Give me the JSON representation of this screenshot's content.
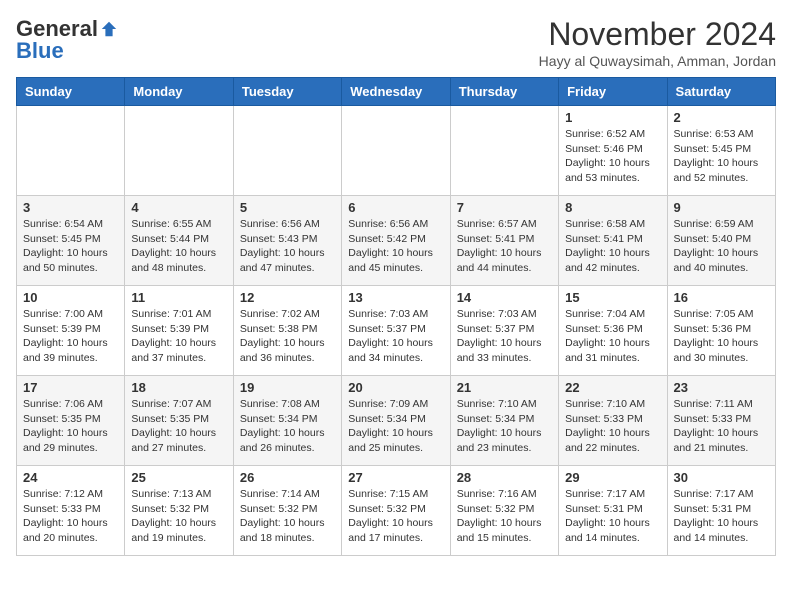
{
  "logo": {
    "general": "General",
    "blue": "Blue"
  },
  "header": {
    "month": "November 2024",
    "location": "Hayy al Quwaysimah, Amman, Jordan"
  },
  "days": [
    "Sunday",
    "Monday",
    "Tuesday",
    "Wednesday",
    "Thursday",
    "Friday",
    "Saturday"
  ],
  "weeks": [
    [
      {
        "day": "",
        "info": ""
      },
      {
        "day": "",
        "info": ""
      },
      {
        "day": "",
        "info": ""
      },
      {
        "day": "",
        "info": ""
      },
      {
        "day": "",
        "info": ""
      },
      {
        "day": "1",
        "info": "Sunrise: 6:52 AM\nSunset: 5:46 PM\nDaylight: 10 hours and 53 minutes."
      },
      {
        "day": "2",
        "info": "Sunrise: 6:53 AM\nSunset: 5:45 PM\nDaylight: 10 hours and 52 minutes."
      }
    ],
    [
      {
        "day": "3",
        "info": "Sunrise: 6:54 AM\nSunset: 5:45 PM\nDaylight: 10 hours and 50 minutes."
      },
      {
        "day": "4",
        "info": "Sunrise: 6:55 AM\nSunset: 5:44 PM\nDaylight: 10 hours and 48 minutes."
      },
      {
        "day": "5",
        "info": "Sunrise: 6:56 AM\nSunset: 5:43 PM\nDaylight: 10 hours and 47 minutes."
      },
      {
        "day": "6",
        "info": "Sunrise: 6:56 AM\nSunset: 5:42 PM\nDaylight: 10 hours and 45 minutes."
      },
      {
        "day": "7",
        "info": "Sunrise: 6:57 AM\nSunset: 5:41 PM\nDaylight: 10 hours and 44 minutes."
      },
      {
        "day": "8",
        "info": "Sunrise: 6:58 AM\nSunset: 5:41 PM\nDaylight: 10 hours and 42 minutes."
      },
      {
        "day": "9",
        "info": "Sunrise: 6:59 AM\nSunset: 5:40 PM\nDaylight: 10 hours and 40 minutes."
      }
    ],
    [
      {
        "day": "10",
        "info": "Sunrise: 7:00 AM\nSunset: 5:39 PM\nDaylight: 10 hours and 39 minutes."
      },
      {
        "day": "11",
        "info": "Sunrise: 7:01 AM\nSunset: 5:39 PM\nDaylight: 10 hours and 37 minutes."
      },
      {
        "day": "12",
        "info": "Sunrise: 7:02 AM\nSunset: 5:38 PM\nDaylight: 10 hours and 36 minutes."
      },
      {
        "day": "13",
        "info": "Sunrise: 7:03 AM\nSunset: 5:37 PM\nDaylight: 10 hours and 34 minutes."
      },
      {
        "day": "14",
        "info": "Sunrise: 7:03 AM\nSunset: 5:37 PM\nDaylight: 10 hours and 33 minutes."
      },
      {
        "day": "15",
        "info": "Sunrise: 7:04 AM\nSunset: 5:36 PM\nDaylight: 10 hours and 31 minutes."
      },
      {
        "day": "16",
        "info": "Sunrise: 7:05 AM\nSunset: 5:36 PM\nDaylight: 10 hours and 30 minutes."
      }
    ],
    [
      {
        "day": "17",
        "info": "Sunrise: 7:06 AM\nSunset: 5:35 PM\nDaylight: 10 hours and 29 minutes."
      },
      {
        "day": "18",
        "info": "Sunrise: 7:07 AM\nSunset: 5:35 PM\nDaylight: 10 hours and 27 minutes."
      },
      {
        "day": "19",
        "info": "Sunrise: 7:08 AM\nSunset: 5:34 PM\nDaylight: 10 hours and 26 minutes."
      },
      {
        "day": "20",
        "info": "Sunrise: 7:09 AM\nSunset: 5:34 PM\nDaylight: 10 hours and 25 minutes."
      },
      {
        "day": "21",
        "info": "Sunrise: 7:10 AM\nSunset: 5:34 PM\nDaylight: 10 hours and 23 minutes."
      },
      {
        "day": "22",
        "info": "Sunrise: 7:10 AM\nSunset: 5:33 PM\nDaylight: 10 hours and 22 minutes."
      },
      {
        "day": "23",
        "info": "Sunrise: 7:11 AM\nSunset: 5:33 PM\nDaylight: 10 hours and 21 minutes."
      }
    ],
    [
      {
        "day": "24",
        "info": "Sunrise: 7:12 AM\nSunset: 5:33 PM\nDaylight: 10 hours and 20 minutes."
      },
      {
        "day": "25",
        "info": "Sunrise: 7:13 AM\nSunset: 5:32 PM\nDaylight: 10 hours and 19 minutes."
      },
      {
        "day": "26",
        "info": "Sunrise: 7:14 AM\nSunset: 5:32 PM\nDaylight: 10 hours and 18 minutes."
      },
      {
        "day": "27",
        "info": "Sunrise: 7:15 AM\nSunset: 5:32 PM\nDaylight: 10 hours and 17 minutes."
      },
      {
        "day": "28",
        "info": "Sunrise: 7:16 AM\nSunset: 5:32 PM\nDaylight: 10 hours and 15 minutes."
      },
      {
        "day": "29",
        "info": "Sunrise: 7:17 AM\nSunset: 5:31 PM\nDaylight: 10 hours and 14 minutes."
      },
      {
        "day": "30",
        "info": "Sunrise: 7:17 AM\nSunset: 5:31 PM\nDaylight: 10 hours and 14 minutes."
      }
    ]
  ]
}
